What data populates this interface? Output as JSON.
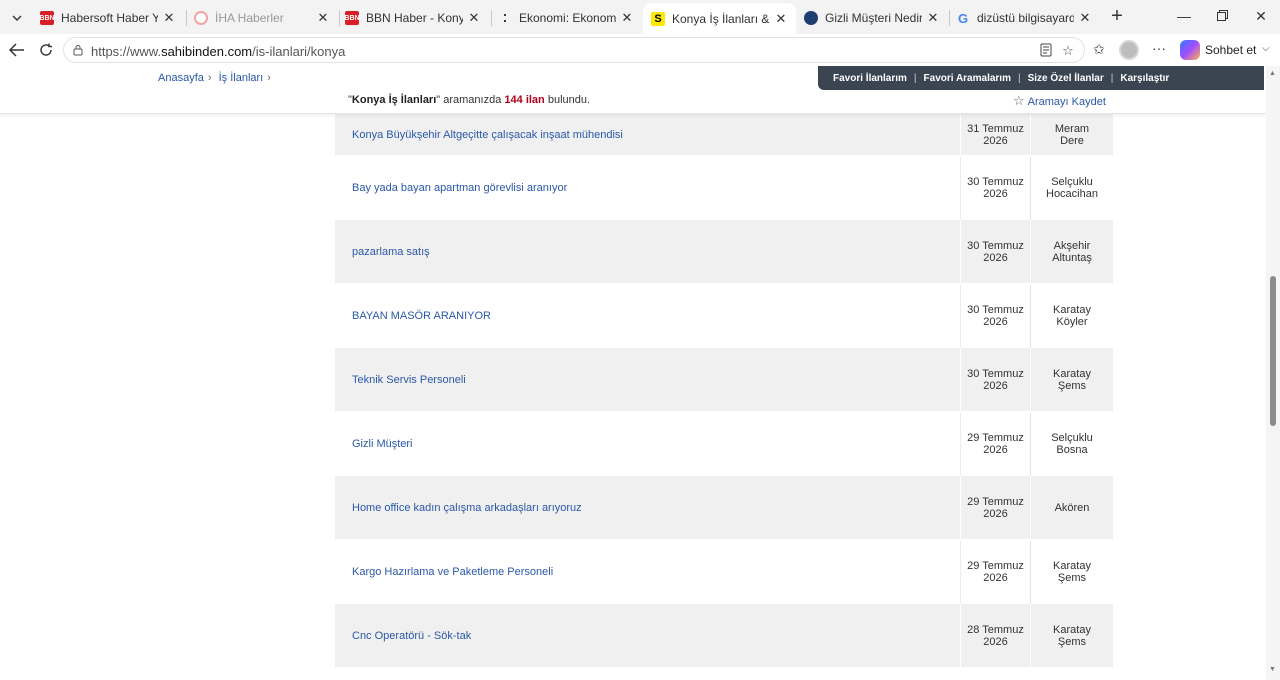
{
  "browser": {
    "tabs": [
      {
        "title": "Habersoft Haber Yazılım",
        "favicon": "hbs-logo-icon",
        "color": "#d61f26",
        "fav_text": "BBN",
        "active": false
      },
      {
        "title": "İHA Haberler",
        "favicon": "iha-logo-icon",
        "color": "#f4a3a3",
        "fav_text": "",
        "active": false
      },
      {
        "title": "BBN Haber - Konya Son",
        "favicon": "bbn-logo-icon",
        "color": "#d61f26",
        "fav_text": "BBN",
        "active": false
      },
      {
        "title": "Ekonomi: Ekonomi Habe",
        "favicon": "dots-icon",
        "color": "#333333",
        "fav_text": "",
        "active": false
      },
      {
        "title": "Konya İş İlanları & Elem",
        "favicon": "sahibinden-logo-icon",
        "color": "#ffe800",
        "fav_text": "S",
        "active": true
      },
      {
        "title": "Gizli Müşteri Nedir, Ne",
        "favicon": "globe-logo-icon",
        "color": "#1f3f73",
        "fav_text": "",
        "active": false
      },
      {
        "title": "dizüstü bilgisayarda ek",
        "favicon": "google-icon",
        "color": "#4285f4",
        "fav_text": "G",
        "active": false
      }
    ],
    "url_prefix": "https://www.",
    "url_domain": "sahibinden.com",
    "url_path": "/is-ilanlari/konya",
    "copilot_label": "Sohbet et"
  },
  "page": {
    "breadcrumb": [
      "Anasayfa",
      "İş İlanları"
    ],
    "favorites_bar": [
      "Favori İlanlarım",
      "Favori Aramalarım",
      "Size Özel İlanlar",
      "Karşılaştır"
    ],
    "search_query": "Konya İş İlanları",
    "result_mid": "aramanızda",
    "result_count": "144 ilan",
    "result_suffix": "bulundu.",
    "save_search": "Aramayı Kaydet",
    "listings": [
      {
        "title": "Konya Büyükşehir Altgeçitte çalışacak inşaat mühendisi",
        "date1": "31 Temmuz",
        "date2": "2026",
        "loc1": "Meram",
        "loc2": "Dere"
      },
      {
        "title": "Bay yada bayan apartman görevlisi aranıyor",
        "date1": "30 Temmuz",
        "date2": "2026",
        "loc1": "Selçuklu",
        "loc2": "Hocacihan"
      },
      {
        "title": "pazarlama satış",
        "date1": "30 Temmuz",
        "date2": "2026",
        "loc1": "Akşehir",
        "loc2": "Altuntaş"
      },
      {
        "title": "BAYAN MASÖR ARANIYOR",
        "date1": "30 Temmuz",
        "date2": "2026",
        "loc1": "Karatay",
        "loc2": "Köyler"
      },
      {
        "title": "Teknik Servis Personeli",
        "date1": "30 Temmuz",
        "date2": "2026",
        "loc1": "Karatay",
        "loc2": "Şems"
      },
      {
        "title": "Gizli Müşteri",
        "date1": "29 Temmuz",
        "date2": "2026",
        "loc1": "Selçuklu",
        "loc2": "Bosna"
      },
      {
        "title": "Home office kadın çalışma arkadaşları arıyoruz",
        "date1": "29 Temmuz",
        "date2": "2026",
        "loc1": "Akören",
        "loc2": ""
      },
      {
        "title": "Kargo Hazırlama ve Paketleme Personeli",
        "date1": "29 Temmuz",
        "date2": "2026",
        "loc1": "Karatay",
        "loc2": "Şems"
      },
      {
        "title": "Cnc Operatörü - Sök-tak",
        "date1": "28 Temmuz",
        "date2": "2026",
        "loc1": "Karatay",
        "loc2": "Şems"
      }
    ]
  }
}
